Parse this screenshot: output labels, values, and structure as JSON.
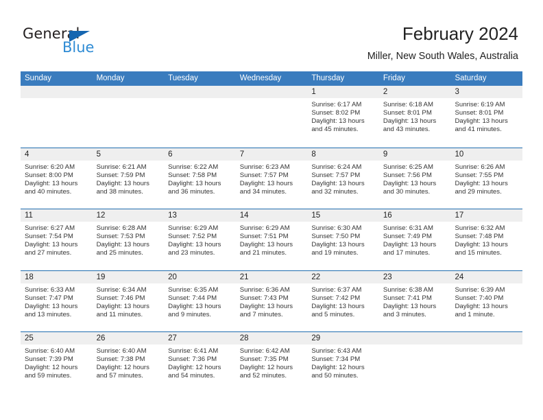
{
  "brand": {
    "name_top": "General",
    "name_bottom": "Blue",
    "accent_blue": "#2e8bd4",
    "triangle_blue": "#1666b0"
  },
  "header": {
    "title": "February 2024",
    "subtitle": "Miller, New South Wales, Australia"
  },
  "theme": {
    "header_row_bg": "#3a7cbe",
    "row_divider": "#1f6cae",
    "day_band_bg": "#efefef",
    "text": "#333333"
  },
  "weekdays": [
    "Sunday",
    "Monday",
    "Tuesday",
    "Wednesday",
    "Thursday",
    "Friday",
    "Saturday"
  ],
  "labels": {
    "sunrise": "Sunrise:",
    "sunset": "Sunset:",
    "daylight": "Daylight:"
  },
  "weeks": [
    [
      {
        "day": "",
        "empty": true
      },
      {
        "day": "",
        "empty": true
      },
      {
        "day": "",
        "empty": true
      },
      {
        "day": "",
        "empty": true
      },
      {
        "day": "1",
        "sunrise": "Sunrise: 6:17 AM",
        "sunset": "Sunset: 8:02 PM",
        "daylight_1": "Daylight: 13 hours",
        "daylight_2": "and 45 minutes."
      },
      {
        "day": "2",
        "sunrise": "Sunrise: 6:18 AM",
        "sunset": "Sunset: 8:01 PM",
        "daylight_1": "Daylight: 13 hours",
        "daylight_2": "and 43 minutes."
      },
      {
        "day": "3",
        "sunrise": "Sunrise: 6:19 AM",
        "sunset": "Sunset: 8:01 PM",
        "daylight_1": "Daylight: 13 hours",
        "daylight_2": "and 41 minutes."
      }
    ],
    [
      {
        "day": "4",
        "sunrise": "Sunrise: 6:20 AM",
        "sunset": "Sunset: 8:00 PM",
        "daylight_1": "Daylight: 13 hours",
        "daylight_2": "and 40 minutes."
      },
      {
        "day": "5",
        "sunrise": "Sunrise: 6:21 AM",
        "sunset": "Sunset: 7:59 PM",
        "daylight_1": "Daylight: 13 hours",
        "daylight_2": "and 38 minutes."
      },
      {
        "day": "6",
        "sunrise": "Sunrise: 6:22 AM",
        "sunset": "Sunset: 7:58 PM",
        "daylight_1": "Daylight: 13 hours",
        "daylight_2": "and 36 minutes."
      },
      {
        "day": "7",
        "sunrise": "Sunrise: 6:23 AM",
        "sunset": "Sunset: 7:57 PM",
        "daylight_1": "Daylight: 13 hours",
        "daylight_2": "and 34 minutes."
      },
      {
        "day": "8",
        "sunrise": "Sunrise: 6:24 AM",
        "sunset": "Sunset: 7:57 PM",
        "daylight_1": "Daylight: 13 hours",
        "daylight_2": "and 32 minutes."
      },
      {
        "day": "9",
        "sunrise": "Sunrise: 6:25 AM",
        "sunset": "Sunset: 7:56 PM",
        "daylight_1": "Daylight: 13 hours",
        "daylight_2": "and 30 minutes."
      },
      {
        "day": "10",
        "sunrise": "Sunrise: 6:26 AM",
        "sunset": "Sunset: 7:55 PM",
        "daylight_1": "Daylight: 13 hours",
        "daylight_2": "and 29 minutes."
      }
    ],
    [
      {
        "day": "11",
        "sunrise": "Sunrise: 6:27 AM",
        "sunset": "Sunset: 7:54 PM",
        "daylight_1": "Daylight: 13 hours",
        "daylight_2": "and 27 minutes."
      },
      {
        "day": "12",
        "sunrise": "Sunrise: 6:28 AM",
        "sunset": "Sunset: 7:53 PM",
        "daylight_1": "Daylight: 13 hours",
        "daylight_2": "and 25 minutes."
      },
      {
        "day": "13",
        "sunrise": "Sunrise: 6:29 AM",
        "sunset": "Sunset: 7:52 PM",
        "daylight_1": "Daylight: 13 hours",
        "daylight_2": "and 23 minutes."
      },
      {
        "day": "14",
        "sunrise": "Sunrise: 6:29 AM",
        "sunset": "Sunset: 7:51 PM",
        "daylight_1": "Daylight: 13 hours",
        "daylight_2": "and 21 minutes."
      },
      {
        "day": "15",
        "sunrise": "Sunrise: 6:30 AM",
        "sunset": "Sunset: 7:50 PM",
        "daylight_1": "Daylight: 13 hours",
        "daylight_2": "and 19 minutes."
      },
      {
        "day": "16",
        "sunrise": "Sunrise: 6:31 AM",
        "sunset": "Sunset: 7:49 PM",
        "daylight_1": "Daylight: 13 hours",
        "daylight_2": "and 17 minutes."
      },
      {
        "day": "17",
        "sunrise": "Sunrise: 6:32 AM",
        "sunset": "Sunset: 7:48 PM",
        "daylight_1": "Daylight: 13 hours",
        "daylight_2": "and 15 minutes."
      }
    ],
    [
      {
        "day": "18",
        "sunrise": "Sunrise: 6:33 AM",
        "sunset": "Sunset: 7:47 PM",
        "daylight_1": "Daylight: 13 hours",
        "daylight_2": "and 13 minutes."
      },
      {
        "day": "19",
        "sunrise": "Sunrise: 6:34 AM",
        "sunset": "Sunset: 7:46 PM",
        "daylight_1": "Daylight: 13 hours",
        "daylight_2": "and 11 minutes."
      },
      {
        "day": "20",
        "sunrise": "Sunrise: 6:35 AM",
        "sunset": "Sunset: 7:44 PM",
        "daylight_1": "Daylight: 13 hours",
        "daylight_2": "and 9 minutes."
      },
      {
        "day": "21",
        "sunrise": "Sunrise: 6:36 AM",
        "sunset": "Sunset: 7:43 PM",
        "daylight_1": "Daylight: 13 hours",
        "daylight_2": "and 7 minutes."
      },
      {
        "day": "22",
        "sunrise": "Sunrise: 6:37 AM",
        "sunset": "Sunset: 7:42 PM",
        "daylight_1": "Daylight: 13 hours",
        "daylight_2": "and 5 minutes."
      },
      {
        "day": "23",
        "sunrise": "Sunrise: 6:38 AM",
        "sunset": "Sunset: 7:41 PM",
        "daylight_1": "Daylight: 13 hours",
        "daylight_2": "and 3 minutes."
      },
      {
        "day": "24",
        "sunrise": "Sunrise: 6:39 AM",
        "sunset": "Sunset: 7:40 PM",
        "daylight_1": "Daylight: 13 hours",
        "daylight_2": "and 1 minute."
      }
    ],
    [
      {
        "day": "25",
        "sunrise": "Sunrise: 6:40 AM",
        "sunset": "Sunset: 7:39 PM",
        "daylight_1": "Daylight: 12 hours",
        "daylight_2": "and 59 minutes."
      },
      {
        "day": "26",
        "sunrise": "Sunrise: 6:40 AM",
        "sunset": "Sunset: 7:38 PM",
        "daylight_1": "Daylight: 12 hours",
        "daylight_2": "and 57 minutes."
      },
      {
        "day": "27",
        "sunrise": "Sunrise: 6:41 AM",
        "sunset": "Sunset: 7:36 PM",
        "daylight_1": "Daylight: 12 hours",
        "daylight_2": "and 54 minutes."
      },
      {
        "day": "28",
        "sunrise": "Sunrise: 6:42 AM",
        "sunset": "Sunset: 7:35 PM",
        "daylight_1": "Daylight: 12 hours",
        "daylight_2": "and 52 minutes."
      },
      {
        "day": "29",
        "sunrise": "Sunrise: 6:43 AM",
        "sunset": "Sunset: 7:34 PM",
        "daylight_1": "Daylight: 12 hours",
        "daylight_2": "and 50 minutes."
      },
      {
        "day": "",
        "empty": true
      },
      {
        "day": "",
        "empty": true
      }
    ]
  ]
}
